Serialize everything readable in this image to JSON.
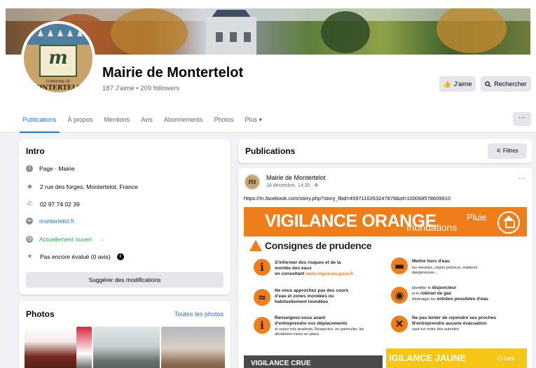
{
  "page": {
    "title": "Mairie de Montertelot",
    "stats": "187 J'aime • 209 followers"
  },
  "header_buttons": {
    "like": "J'aime",
    "search": "Rechercher"
  },
  "avatar": {
    "monogram": "m",
    "small_text": "COMMUNE DE",
    "big_text": "MONTERTELOT"
  },
  "tabs": [
    "Publications",
    "À propos",
    "Mentions",
    "Avis",
    "Abonnements",
    "Photos",
    "Plus ▾"
  ],
  "more_button": "···",
  "intro": {
    "heading": "Intro",
    "items": [
      {
        "icon": "info-icon",
        "text": "Page · Mairie"
      },
      {
        "icon": "location-icon",
        "text": "2 rue des forges, Montertelot, France"
      },
      {
        "icon": "phone-icon",
        "text": "02 97 74 02 39"
      },
      {
        "icon": "globe-icon",
        "text": "montertelot.fr"
      },
      {
        "icon": "clock-icon",
        "text": "Actuellement ouvert"
      },
      {
        "icon": "star-icon",
        "text": "Pas encore évalué (0 avis)"
      }
    ],
    "suggest_button": "Suggérer des modifications"
  },
  "photos": {
    "heading": "Photos",
    "see_all": "Toutes les photos"
  },
  "publications": {
    "heading": "Publications",
    "filters": "Filtres"
  },
  "post": {
    "author": "Mairie de Montertelot",
    "date": "18 décembre, 14:35 · ",
    "url": "https://m.facebook.com/story.php?story_fbid=4597116263247878&id=100068578609910"
  },
  "poster": {
    "title": "VIGILANCE ORANGE",
    "sub1": "Pluie",
    "sub2": "Inondations",
    "consignes": "Consignes de prudence",
    "item1_line1": "S'informer des risques et de la",
    "item1_line2": "montée des eaux",
    "item1_line3": "en consultant",
    "item1_link": "www.vigicrues.gouv.fr",
    "item2_line1": "Ne vous approchez pas des cours",
    "item2_line2": "d'eau et zones inondées ou",
    "item2_line3": "habituellement inondées",
    "item3_line1": "Renseignez-vous avant",
    "item3_line2": "d'entreprendre vos déplacements",
    "item3_small": "et soyez très prudents. Respectez, en particulier, les déviations mises en place",
    "item4_line1": "Mettre hors d'eau",
    "item4_small": "les meubles, objets précieux, matières dangereuses...",
    "item5_small1": "Identifier le",
    "item5_b1": "disjoncteur",
    "item5_small2": "et le",
    "item5_b2": "robinet de gaz",
    "item5_small3": "Aménager les",
    "item5_b3": "entrées possibles d'eau",
    "item6_line1": "Ne pas tenter de rejoindre ses proches",
    "item6_line2": "N'entreprendre aucune évacuation",
    "item6_small": "sauf sur ordre des autorités",
    "bottom1": "VIGILANCE CRUE",
    "bottom2": "IGILANCE JAUNE",
    "bottom2_sub": "Crues"
  },
  "colors": {
    "accent": "#1b74e4",
    "orange": "#ef7d1a",
    "yellow": "#f5c518",
    "open_green": "#31a24c"
  }
}
